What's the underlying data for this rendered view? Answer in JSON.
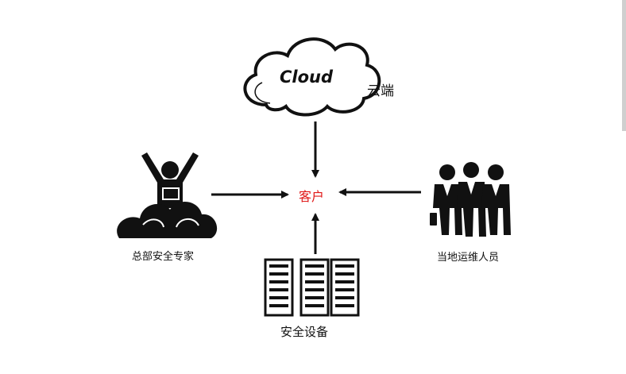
{
  "nodes": {
    "cloud": {
      "icon": "cloud-icon",
      "text": "Cloud",
      "label": "云端"
    },
    "client": {
      "label": "客户",
      "color": "#e01818"
    },
    "expert": {
      "icon": "cheering-person-on-cloud-icon",
      "label": "总部安全专家"
    },
    "staff": {
      "icon": "business-people-group-icon",
      "label": "当地运维人员"
    },
    "equipment": {
      "icon": "server-racks-icon",
      "label": "安全设备"
    }
  },
  "edges": [
    {
      "from": "cloud",
      "to": "client"
    },
    {
      "from": "expert",
      "to": "client"
    },
    {
      "from": "staff",
      "to": "client"
    },
    {
      "from": "equipment",
      "to": "client"
    }
  ]
}
